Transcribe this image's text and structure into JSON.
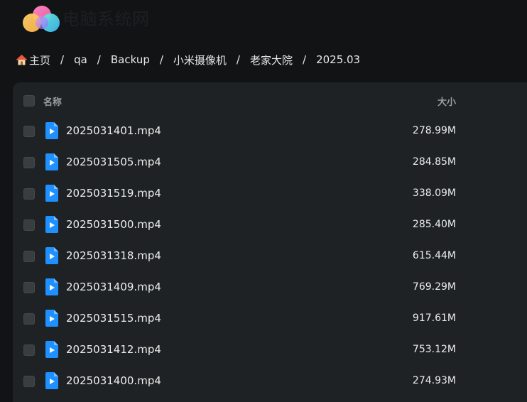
{
  "brand": {
    "name": "电脑系统网"
  },
  "breadcrumb": [
    {
      "label": "主页",
      "icon": "home-icon"
    },
    {
      "label": "qa"
    },
    {
      "label": "Backup"
    },
    {
      "label": "小米摄像机"
    },
    {
      "label": "老家大院"
    },
    {
      "label": "2025.03"
    }
  ],
  "separator": "/",
  "table": {
    "headers": {
      "name": "名称",
      "size": "大小"
    },
    "rows": [
      {
        "name": "2025031401.mp4",
        "size": "278.99M"
      },
      {
        "name": "2025031505.mp4",
        "size": "284.85M"
      },
      {
        "name": "2025031519.mp4",
        "size": "338.09M"
      },
      {
        "name": "2025031500.mp4",
        "size": "285.40M"
      },
      {
        "name": "2025031318.mp4",
        "size": "615.44M"
      },
      {
        "name": "2025031409.mp4",
        "size": "769.29M"
      },
      {
        "name": "2025031515.mp4",
        "size": "917.61M"
      },
      {
        "name": "2025031412.mp4",
        "size": "753.12M"
      },
      {
        "name": "2025031400.mp4",
        "size": "274.93M"
      }
    ]
  },
  "colors": {
    "background": "#111315",
    "panel": "#1f2224",
    "accent": "#1e90ff",
    "text": "#ececec",
    "muted": "#9a9ea2"
  }
}
